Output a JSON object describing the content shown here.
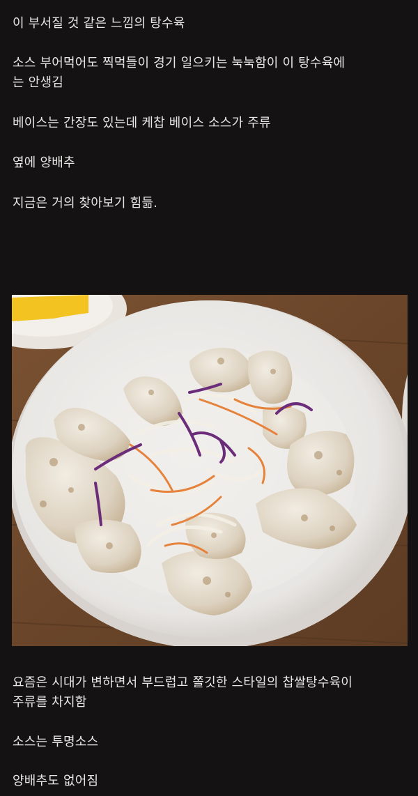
{
  "post": {
    "lines_top": [
      "이 부서질 것 같은 느낌의 탕수육",
      "소스 부어먹어도 찍먹들이 경기 일으키는 눅눅함이 이 탕수육에",
      "는 안생김",
      "베이스는 간장도 있는데 케찹 베이스 소스가 주류",
      "옆에 양배추",
      "지금은 거의 찾아보기 힘듦."
    ],
    "lines_bottom": [
      "요즘은 시대가 변하면서 부드럽고 쫄깃한 스타일의 찹쌀탕수육이",
      "주류를 차지함",
      "소스는 투명소스",
      "양배추도 없어짐"
    ]
  },
  "colors": {
    "background": "#141213",
    "text": "#e9e7e6"
  }
}
